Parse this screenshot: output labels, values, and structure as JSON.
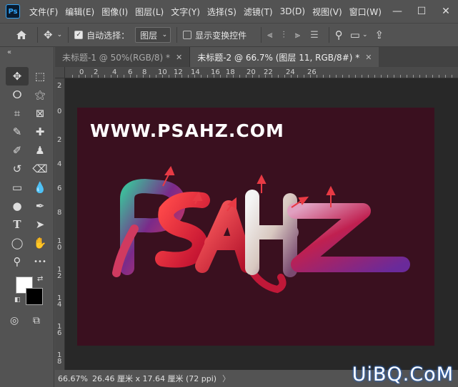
{
  "menubar": {
    "logo": "Ps",
    "items": [
      "文件(F)",
      "编辑(E)",
      "图像(I)",
      "图层(L)",
      "文字(Y)",
      "选择(S)",
      "滤镜(T)",
      "3D(D)",
      "视图(V)",
      "窗口(W)"
    ],
    "window_controls": [
      "minimize-icon",
      "maximize-icon",
      "close-icon"
    ]
  },
  "options": {
    "auto_select_label": "自动选择：",
    "auto_select_checked": true,
    "auto_select_target": "图层",
    "show_transform_label": "显示变换控件",
    "show_transform_checked": false
  },
  "tools": [
    {
      "name": "move-tool",
      "glyph": "✥"
    },
    {
      "name": "marquee-tool",
      "glyph": "⬚"
    },
    {
      "name": "lasso-tool",
      "glyph": "ⵔ"
    },
    {
      "name": "magic-wand-tool",
      "glyph": "⚝"
    },
    {
      "name": "crop-tool",
      "glyph": "⌗"
    },
    {
      "name": "frame-tool",
      "glyph": "⊠"
    },
    {
      "name": "eyedropper-tool",
      "glyph": "✎"
    },
    {
      "name": "healing-brush-tool",
      "glyph": "✚"
    },
    {
      "name": "brush-tool",
      "glyph": "✐"
    },
    {
      "name": "stamp-tool",
      "glyph": "♟"
    },
    {
      "name": "history-brush-tool",
      "glyph": "↺"
    },
    {
      "name": "eraser-tool",
      "glyph": "⌫"
    },
    {
      "name": "gradient-tool",
      "glyph": "▭"
    },
    {
      "name": "blur-tool",
      "glyph": "💧"
    },
    {
      "name": "dodge-tool",
      "glyph": "●"
    },
    {
      "name": "pen-tool",
      "glyph": "✒"
    },
    {
      "name": "type-tool",
      "glyph": "T"
    },
    {
      "name": "path-selection-tool",
      "glyph": "➤"
    },
    {
      "name": "ellipse-tool",
      "glyph": "◯"
    },
    {
      "name": "hand-tool",
      "glyph": "✋"
    },
    {
      "name": "zoom-tool",
      "glyph": "⚲"
    },
    {
      "name": "more-tools",
      "glyph": "•••"
    }
  ],
  "tabs": [
    {
      "label": "未标题-1 @ 50%(RGB/8) *",
      "active": false
    },
    {
      "label": "未标题-2 @ 66.7% (图层 11, RGB/8#) *",
      "active": true
    }
  ],
  "ruler_top": [
    "0",
    "2",
    "4",
    "6",
    "8",
    "10",
    "12",
    "14",
    "16",
    "18",
    "20",
    "22",
    "24",
    "26"
  ],
  "ruler_left": [
    "2",
    "0",
    "2",
    "4",
    "6",
    "8",
    "1 0",
    "1 2",
    "1 4",
    "1 6",
    "1 8"
  ],
  "canvas": {
    "watermark_text": "WWW.PSAHZ.COM",
    "artwork_text": "PSAHZ",
    "background": "#3a101f"
  },
  "status": {
    "zoom": "66.67%",
    "doc_size": "26.46 厘米 x 17.64 厘米 (72 ppi)",
    "chevron": "〉"
  },
  "site_watermark": "UiBQ.CoM"
}
